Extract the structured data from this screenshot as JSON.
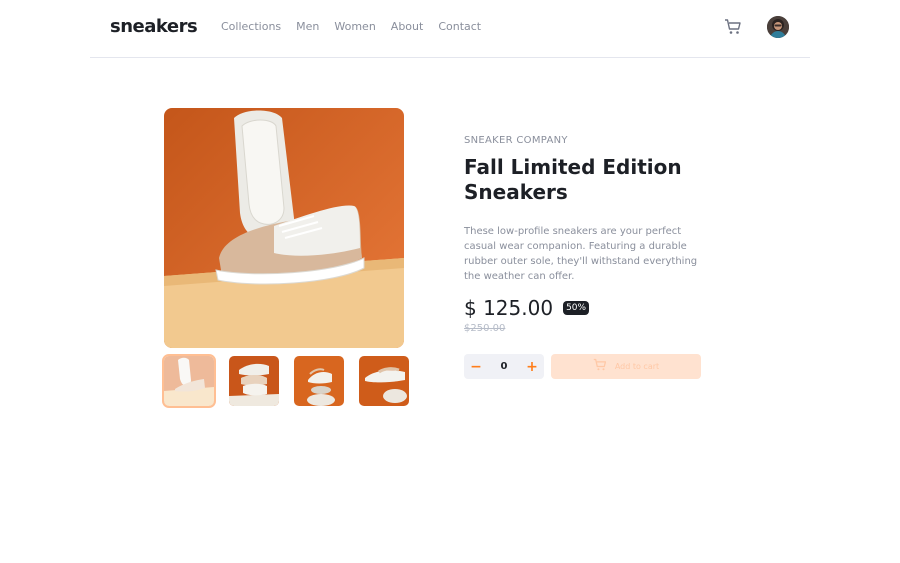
{
  "header": {
    "logo": "sneakers",
    "nav": [
      "Collections",
      "Men",
      "Women",
      "About",
      "Contact"
    ],
    "cart_icon": "cart-icon",
    "avatar_icon": "avatar"
  },
  "product": {
    "company": "SNEAKER COMPANY",
    "title": "Fall Limited Edition Sneakers",
    "description": "These low-profile sneakers are your perfect casual wear companion. Featuring a durable rubber outer sole, they'll withstand everything the weather can offer.",
    "price": "$ 125.00",
    "discount": "50%",
    "old_price": "$250.00",
    "quantity": "0",
    "decrement": "−",
    "increment": "+",
    "add_to_cart": "Add to cart"
  },
  "gallery": {
    "selected_index": 0,
    "thumbnail_count": 4
  },
  "colors": {
    "accent": "#ff7e1b",
    "accent_pale": "#ffe2d0",
    "dark": "#1d2026",
    "muted": "#8a8f9c"
  }
}
